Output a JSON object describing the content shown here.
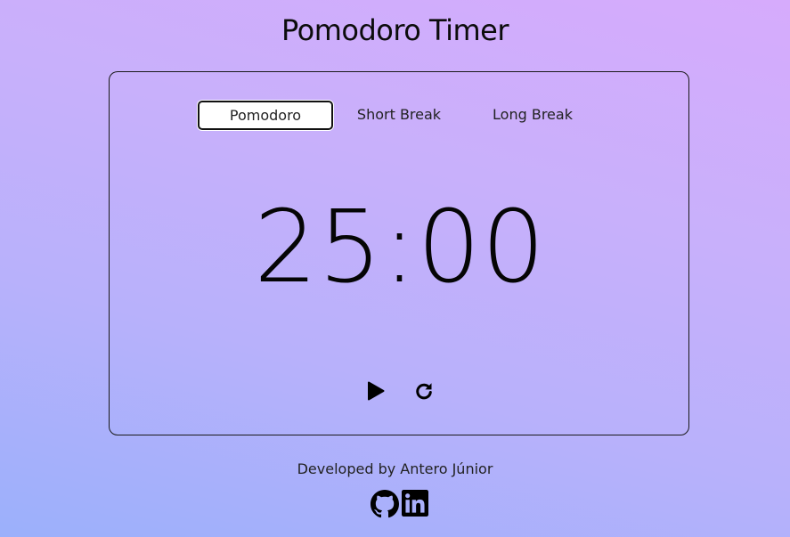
{
  "header": {
    "title": "Pomodoro Timer"
  },
  "modes": {
    "tabs": [
      {
        "label": "Pomodoro",
        "active": true
      },
      {
        "label": "Short Break",
        "active": false
      },
      {
        "label": "Long Break",
        "active": false
      }
    ]
  },
  "timer": {
    "display": "25:00"
  },
  "controls": {
    "play_icon": "play-icon",
    "reset_icon": "reset-icon"
  },
  "footer": {
    "credit": "Developed by Antero Júnior",
    "links": [
      {
        "icon": "github-icon"
      },
      {
        "icon": "linkedin-icon"
      }
    ]
  },
  "colors": {
    "background_start": "#9bb0fb",
    "background_end": "#d6abfc",
    "text": "#111111",
    "active_tab_bg": "#ffffff"
  }
}
